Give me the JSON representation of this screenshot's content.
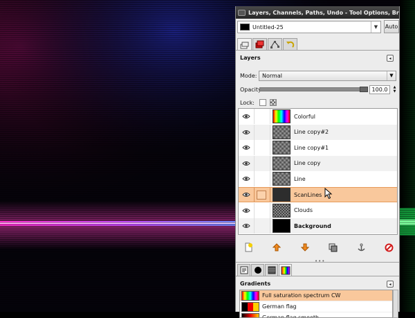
{
  "window": {
    "title": "Layers, Channels, Paths, Undo - Tool Options, Brushes, P"
  },
  "image_selector": {
    "value": "Untitled-25",
    "auto_label": "Auto"
  },
  "layers_panel": {
    "title": "Layers",
    "mode_label": "Mode:",
    "mode_value": "Normal",
    "opacity_label": "Opacity:",
    "opacity_value": "100.0",
    "opacity_fraction": 1.0,
    "lock_label": "Lock:",
    "layers": [
      {
        "name": "Colorful",
        "thumb": "rainbow",
        "bold": false,
        "selected": false
      },
      {
        "name": "Line copy#2",
        "thumb": "checker",
        "bold": false,
        "selected": false
      },
      {
        "name": "Line copy#1",
        "thumb": "checker",
        "bold": false,
        "selected": false
      },
      {
        "name": "Line copy",
        "thumb": "checker",
        "bold": false,
        "selected": false
      },
      {
        "name": "Line",
        "thumb": "checker",
        "bold": false,
        "selected": false
      },
      {
        "name": "ScanLines",
        "thumb": "dark",
        "bold": false,
        "selected": true
      },
      {
        "name": "Clouds",
        "thumb": "clouds",
        "bold": false,
        "selected": false
      },
      {
        "name": "Background",
        "thumb": "black",
        "bold": true,
        "selected": false
      }
    ],
    "buttons": [
      "new-layer-icon",
      "raise-layer-icon",
      "lower-layer-icon",
      "duplicate-layer-icon",
      "anchor-layer-icon",
      "delete-layer-icon"
    ]
  },
  "gradients_panel": {
    "title": "Gradients",
    "items": [
      {
        "name": "Full saturation spectrum CW",
        "selected": true
      },
      {
        "name": "German flag",
        "selected": false
      },
      {
        "name": "German flag smooth",
        "selected": false
      }
    ]
  },
  "colors": {
    "selection": "#f9c89c",
    "accent_orange": "#f08a20",
    "delete_red": "#d21b1b"
  }
}
